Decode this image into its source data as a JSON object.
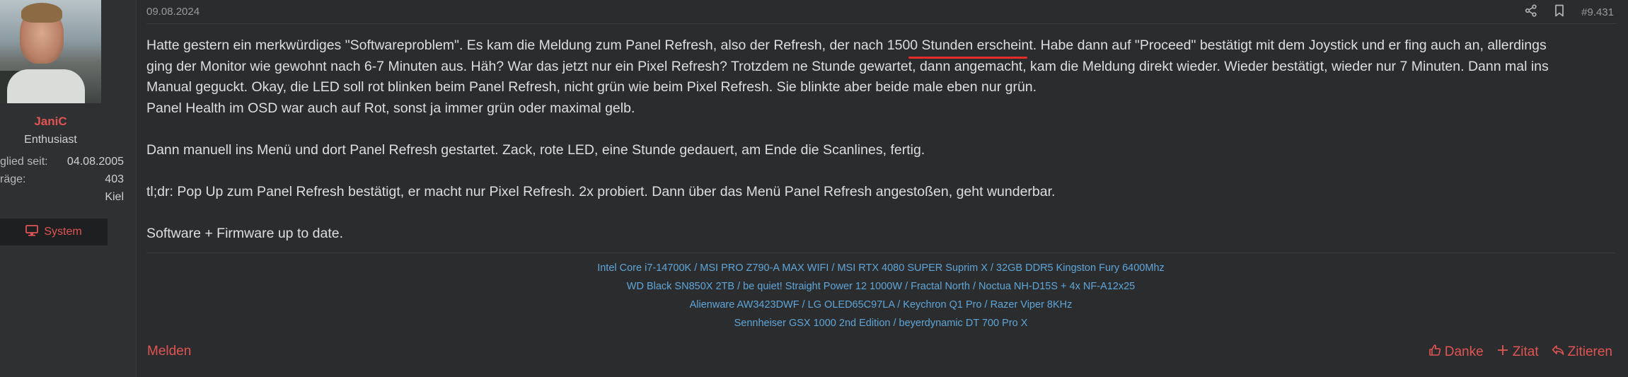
{
  "user": {
    "name": "JaniC",
    "title": "Enthusiast",
    "stats": [
      {
        "label": "glied seit:",
        "value": "04.08.2005"
      },
      {
        "label": "räge:",
        "value": "403"
      },
      {
        "label": "",
        "value": "Kiel"
      }
    ],
    "system_button": "System"
  },
  "post": {
    "date": "09.08.2024",
    "number": "#9.431",
    "paragraphs": [
      "Hatte gestern ein merkwürdiges \"Softwareproblem\". Es kam die Meldung zum Panel Refresh, also der Refresh, der nach 1500 Stunden erscheint. Habe dann auf \"Proceed\" bestätigt mit dem Joystick und er fing auch an, allerdings ging der Monitor wie gewohnt nach 6-7 Minuten aus. Häh? War das jetzt nur ein Pixel Refresh? Trotzdem ne Stunde gewartet, dann angemacht, kam die Meldung direkt wieder. Wieder bestätigt, wieder nur 7 Minuten. Dann mal ins Manual geguckt. Okay, die LED soll rot blinken beim Panel Refresh, nicht grün wie beim Pixel Refresh. Sie blinkte aber beide male eben nur grün.",
      "Panel Health im OSD war auch auf Rot, sonst ja immer grün oder maximal gelb.",
      "Dann manuell ins Menü und dort Panel Refresh gestartet. Zack, rote LED, eine Stunde gedauert, am Ende die Scanlines, fertig.",
      "tl;dr: Pop Up zum Panel Refresh bestätigt, er macht nur Pixel Refresh. 2x probiert. Dann über das Menü Panel Refresh angestoßen, geht wunderbar.",
      "Software + Firmware up to date."
    ]
  },
  "signature": [
    "Intel Core i7-14700K / MSI PRO Z790-A MAX WIFI / MSI RTX 4080 SUPER Suprim X / 32GB DDR5 Kingston Fury 6400Mhz",
    "WD Black SN850X 2TB / be quiet! Straight Power 12 1000W / Fractal North / Noctua NH-D15S + 4x NF-A12x25",
    "Alienware AW3423DWF / LG OLED65C97LA / Keychron Q1 Pro / Razer Viper 8KHz",
    "Sennheiser GSX 1000 2nd Edition / beyerdynamic DT 700 Pro X"
  ],
  "footer": {
    "report": "Melden",
    "thanks": "Danke",
    "quote": "Zitat",
    "reply_quote": "Zitieren"
  },
  "colors": {
    "accent": "#e05454",
    "link": "#5fa6d8",
    "background": "#2b2c2e",
    "underline": "#e52c2c"
  },
  "icons": [
    "monitor-icon",
    "share-icon",
    "bookmark-icon",
    "heart-icon",
    "plus-icon",
    "reply-icon"
  ]
}
